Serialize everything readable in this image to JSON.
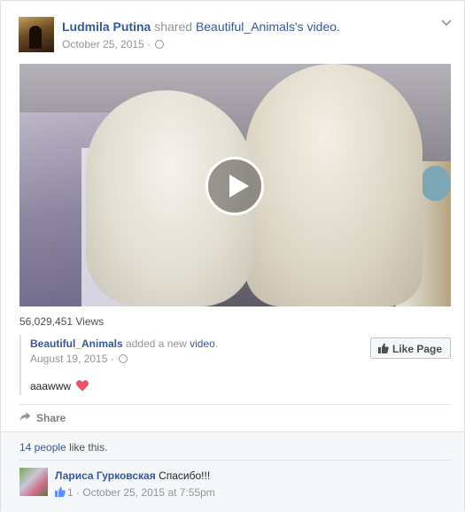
{
  "post": {
    "author": "Ludmila Putina",
    "shared_text": "shared",
    "page_name": "Beautiful_Animals",
    "suffix": "'s video.",
    "date": "October 25, 2015",
    "privacy_sep": "·"
  },
  "video": {
    "views": "56,029,451 Views"
  },
  "attachment": {
    "page_name": "Beautiful_Animals",
    "added_text": "added a new",
    "video_link": "video",
    "period": ".",
    "date": "August 19, 2015",
    "privacy_sep": "·",
    "caption": "aaawww",
    "like_page_label": "Like Page"
  },
  "actions": {
    "share_label": "Share"
  },
  "likes": {
    "people": "14 people",
    "text": "like this."
  },
  "comment": {
    "author": "Лариса Гурковская",
    "text": "Спасибо!!!",
    "like_count": "1",
    "meta_sep": "·",
    "timestamp": "October 25, 2015 at 7:55pm"
  },
  "colors": {
    "link": "#365899",
    "meta": "#90949c",
    "heart": "#f25268"
  },
  "icons": [
    "globe-icon",
    "chevron-down-icon",
    "play-icon",
    "thumbs-up-icon",
    "share-arrow-icon",
    "heart-icon"
  ]
}
